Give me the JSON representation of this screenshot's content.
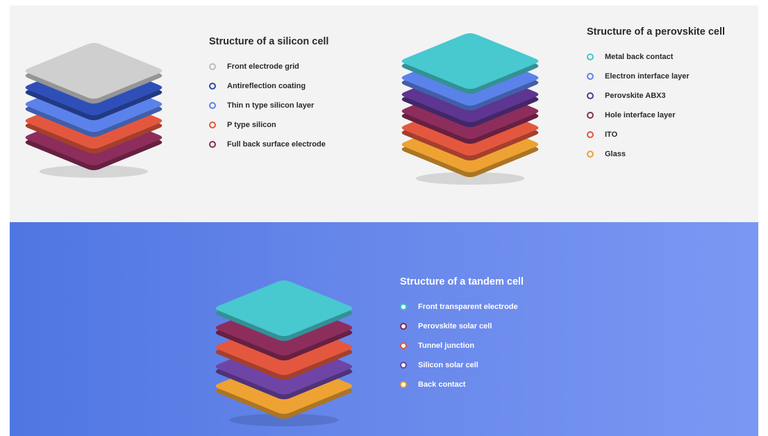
{
  "silicon": {
    "title": "Structure of a silicon cell",
    "layers": [
      {
        "label": "Front electrode grid",
        "color": "#cfcfcf",
        "marker": "#bdbdbd"
      },
      {
        "label": "Antireflection coating",
        "color": "#2f4fb8",
        "marker": "#2b47a8"
      },
      {
        "label": "Thin n type silicon layer",
        "color": "#5b82ea",
        "marker": "#5d83e8"
      },
      {
        "label": "P type silicon",
        "color": "#e4573f",
        "marker": "#e2553d"
      },
      {
        "label": "Full back surface electrode",
        "color": "#8d2d5c",
        "marker": "#882b5a"
      }
    ]
  },
  "perovskite": {
    "title": "Structure of a perovskite cell",
    "layers": [
      {
        "label": "Metal back contact",
        "color": "#48c8cf",
        "marker": "#45c4cc"
      },
      {
        "label": "Electron interface layer",
        "color": "#5b82ea",
        "marker": "#5d83e8"
      },
      {
        "label": "Perovskite ABX3",
        "color": "#5e3590",
        "marker": "#5b3390"
      },
      {
        "label": "Hole interface layer",
        "color": "#8d2d5c",
        "marker": "#882b5a"
      },
      {
        "label": "ITO",
        "color": "#e4573f",
        "marker": "#e2553d"
      },
      {
        "label": "Glass",
        "color": "#eea233",
        "marker": "#eba02f"
      }
    ]
  },
  "tandem": {
    "title": "Structure of a tandem cell",
    "layers": [
      {
        "label": "Front transparent electrode",
        "color": "#48c8cf",
        "marker": "#3fc2cb"
      },
      {
        "label": "Perovskite solar cell",
        "color": "#8d2d5c",
        "marker": "#7e2853"
      },
      {
        "label": "Tunnel junction",
        "color": "#e4573f",
        "marker": "#e2553d"
      },
      {
        "label": "Silicon solar cell",
        "color": "#6e45a6",
        "marker": "#6a43a3"
      },
      {
        "label": "Back contact",
        "color": "#eea233",
        "marker": "#eba02f"
      }
    ]
  }
}
